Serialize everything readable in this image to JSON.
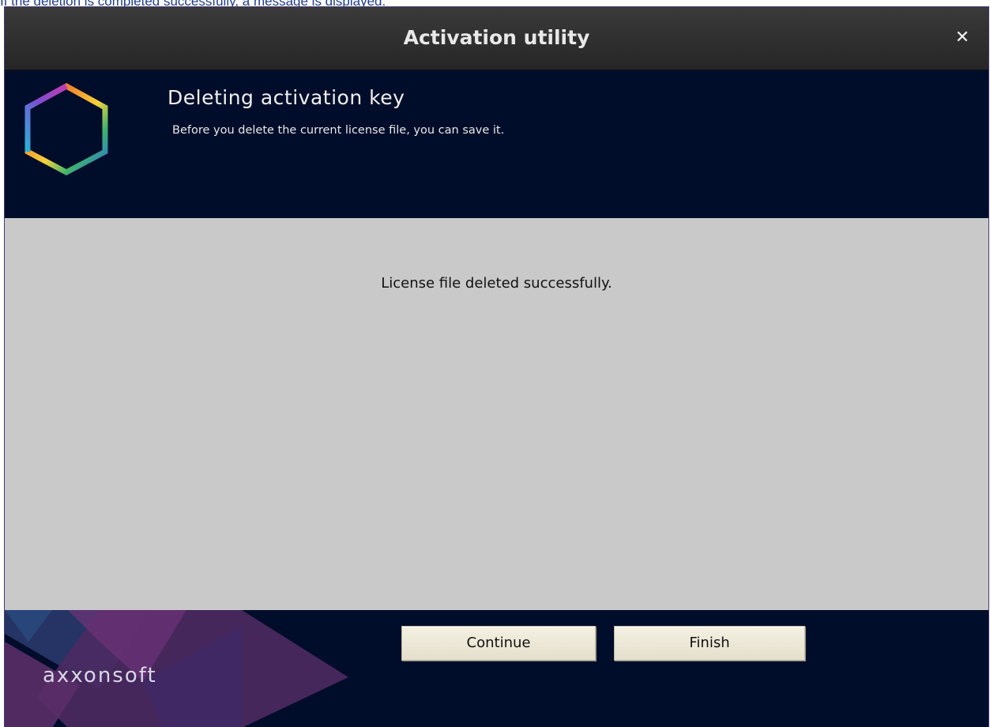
{
  "doc_caption": "If the deletion is completed successfully, a message is displayed.",
  "window": {
    "title": "Activation utility",
    "close_glyph": "✕"
  },
  "header": {
    "title": "Deleting activation key",
    "subtitle": "Before you delete the current license file, you can save it."
  },
  "content": {
    "message": "License file deleted successfully."
  },
  "footer": {
    "brand": "axxonsoft",
    "buttons": {
      "continue": "Continue",
      "finish": "Finish"
    }
  },
  "colors": {
    "header_bg": "#000d2a",
    "content_bg": "#c9c9c9",
    "titlebar_bg": "#2f2f2f",
    "button_bg": "#efebdb"
  }
}
